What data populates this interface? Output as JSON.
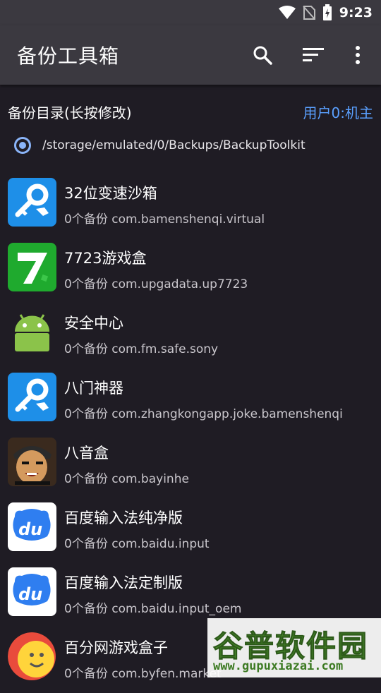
{
  "status_bar": {
    "time": "9:23"
  },
  "toolbar": {
    "title": "备份工具箱"
  },
  "backup_dir": {
    "label": "备份目录(长按修改)",
    "user": "用户0:机主",
    "path": "/storage/emulated/0/Backups/BackupToolkit"
  },
  "apps": [
    {
      "name": "32位变速沙箱",
      "sub": "0个备份 com.bamenshenqi.virtual",
      "icon": "blue-key-wrench-icon"
    },
    {
      "name": "7723游戏盒",
      "sub": "0个备份 com.upgadata.up7723",
      "icon": "green-7-icon"
    },
    {
      "name": "安全中心",
      "sub": "0个备份 com.fm.safe.sony",
      "icon": "android-robot-icon"
    },
    {
      "name": "八门神器",
      "sub": "0个备份 com.zhangkongapp.joke.bamenshenqi",
      "icon": "blue-key-wrench-icon"
    },
    {
      "name": "八音盒",
      "sub": "0个备份 com.bayinhe",
      "icon": "cartoon-face-icon"
    },
    {
      "name": "百度输入法纯净版",
      "sub": "0个备份 com.baidu.input",
      "icon": "baidu-du-icon"
    },
    {
      "name": "百度输入法定制版",
      "sub": "0个备份 com.baidu.input_oem",
      "icon": "baidu-du-icon"
    },
    {
      "name": "百分网游戏盒子",
      "sub": "0个备份 com.byfen.market",
      "icon": "smiley-ball-icon"
    }
  ],
  "watermark": {
    "title": "谷普软件园",
    "url": "www.gupuxiazai.com"
  }
}
